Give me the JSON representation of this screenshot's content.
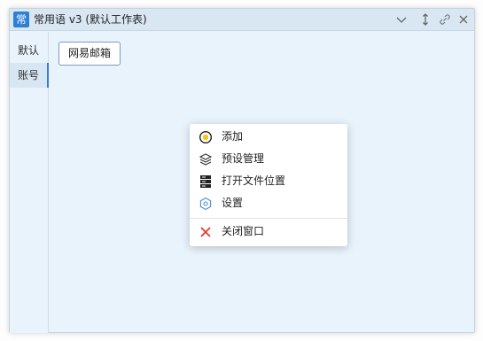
{
  "window": {
    "app_icon_char": "常",
    "title": "常用语 v3 (默认工作表)"
  },
  "sidebar": {
    "tabs": [
      {
        "label": "默认",
        "active": false
      },
      {
        "label": "账号",
        "active": true
      }
    ]
  },
  "content": {
    "items": [
      "网易邮箱"
    ]
  },
  "context_menu": {
    "items": [
      {
        "label": "添加",
        "icon": "add-circle-icon"
      },
      {
        "label": "预设管理",
        "icon": "layers-icon"
      },
      {
        "label": "打开文件位置",
        "icon": "server-icon"
      },
      {
        "label": "设置",
        "icon": "hexagon-gear-icon"
      },
      {
        "label": "关闭窗口",
        "icon": "close-icon"
      }
    ]
  },
  "colors": {
    "accent": "#3a7bd5",
    "window_bg": "#e8f3fb",
    "titlebar_bg": "#d9e7f3",
    "close_red": "#e53935"
  }
}
